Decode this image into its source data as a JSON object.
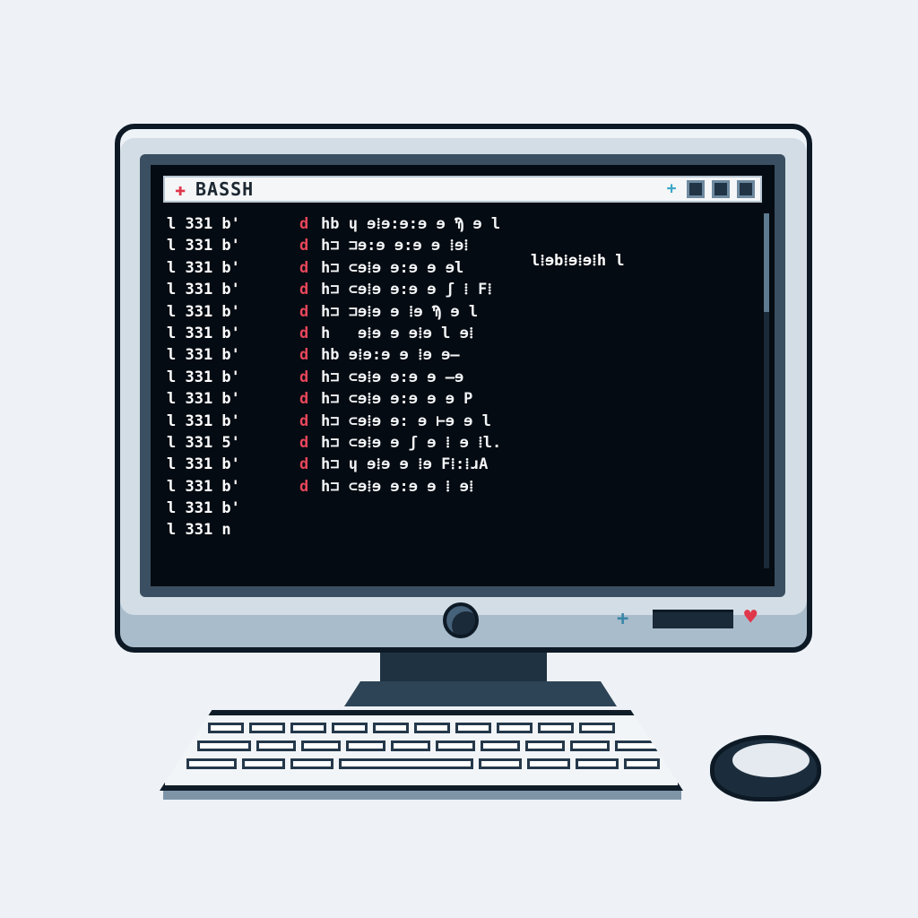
{
  "window": {
    "title": "BASSH",
    "title_icon": "terminal-icon",
    "controls": [
      "restore-icon",
      "minimize-icon",
      "maximize-icon",
      "close-icon"
    ]
  },
  "terminal": {
    "lines": [
      {
        "prefix": "l 331 b'",
        "mark": "d",
        "cmd": "hb ɥ ɘ⁞ɘ:ɘ:ɘ ɘ Ϡ ɘ l"
      },
      {
        "prefix": "l 331 b'",
        "mark": "d",
        "cmd": "h⊐ ⊐ɘ:ɘ ɘ:ɘ ɘ ⁞ɘ⁞"
      },
      {
        "prefix": "l 331 b'",
        "mark": "d",
        "cmd": "h⊐ ⊂ɘ⁞ɘ ɘ:ɘ ɘ ɘl"
      },
      {
        "prefix": "l 331 b'",
        "mark": "d",
        "cmd": "h⊐ ⊂ɘ⁞ɘ ɘ:ɘ ɘ ʃ ⁞ F⁞"
      },
      {
        "prefix": "l 331 b'",
        "mark": "d",
        "cmd": "h⊐ ⊐ɘ⁞ɘ ɘ ⁞ɘ Ϡ ɘ l"
      },
      {
        "prefix": "l 331 b'",
        "mark": "d",
        "cmd": "h   ɘ⁞ɘ ɘ ɘ⁞ɘ l ɘ⁞"
      },
      {
        "prefix": "l 331 b'",
        "mark": "d",
        "cmd": "hb ɘ⁞ɘ:ɘ ɘ ⁞ɘ ɘ—"
      },
      {
        "prefix": "l 331 b'",
        "mark": "d",
        "cmd": "h⊐ ⊂ɘ⁞ɘ ɘ:ɘ ɘ —ɘ"
      },
      {
        "prefix": "l 331 b'",
        "mark": "d",
        "cmd": "h⊐ ⊂ɘ⁞ɘ ɘ:ɘ ɘ ɘ P"
      },
      {
        "prefix": "l 331 b'",
        "mark": "d",
        "cmd": "h⊐ ⊂ɘ⁞ɘ ɘ: ɘ ⊢ɘ ɘ l"
      },
      {
        "prefix": "l 331 5'",
        "mark": "d",
        "cmd": "h⊐ ⊂ɘ⁞ɘ ɘ ʃ ɘ ⁞ ɘ ⁞l."
      },
      {
        "prefix": "l 331 b'",
        "mark": "d",
        "cmd": "h⊐ ɥ ɘ⁞ɘ ɘ ⁞ɘ F⁞:⁞ɹA"
      },
      {
        "prefix": "l 331 b'",
        "mark": "d",
        "cmd": "h⊐ ⊂ɘ⁞ɘ ɘ:ɘ ɘ ⁞ ɘ⁞"
      },
      {
        "prefix": "l 331 b'",
        "mark": "",
        "cmd": ""
      },
      {
        "prefix": "l 331 n",
        "mark": "",
        "cmd": ""
      }
    ],
    "side_output": "l⁞ɘb⁞ɘ⁞ɘ⁞h l"
  },
  "monitor_panel": {
    "power_icon": "power-button-icon",
    "plus_icon": "plus-icon",
    "heart_icon": "heart-icon"
  },
  "colors": {
    "screen": "#050b12",
    "accent_red": "#e8465b",
    "accent_yellow": "#f2c94c",
    "accent_cyan": "#2fb0d6"
  }
}
